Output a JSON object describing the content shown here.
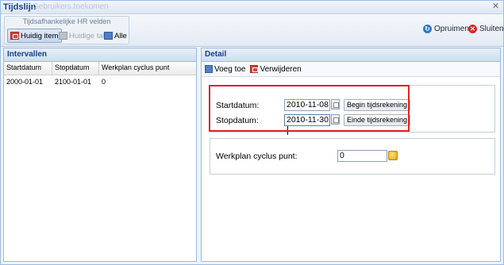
{
  "window": {
    "title": "Tijdslijn",
    "ghost_text": "Gebruikers.toekomen"
  },
  "toolbar": {
    "group_title": "Tijdsafhankelijke HR velden",
    "buttons": [
      {
        "label": "Huidig item",
        "state": "active"
      },
      {
        "label": "Huidige tab",
        "state": "disabled"
      },
      {
        "label": "Alle",
        "state": "normal"
      }
    ],
    "cleanup_label": "Opruimen",
    "close_label": "Sluiten"
  },
  "intervals": {
    "title": "Intervallen",
    "columns": [
      "Startdatum",
      "Stopdatum",
      "Werkplan cyclus punt"
    ],
    "rows": [
      [
        "2000-01-01",
        "2100-01-01",
        "0"
      ]
    ]
  },
  "detail": {
    "title": "Detail",
    "add_label": "Voeg toe",
    "remove_label": "Verwijderen",
    "start_label": "Startdatum:",
    "start_value": "2010-11-08",
    "start_btn": "Begin tijdsrekening",
    "stop_label": "Stopdatum:",
    "stop_value": "2010-11-30",
    "stop_btn": "Einde tijdsrekening",
    "cycle_label": "Werkplan cyclus punt:",
    "cycle_value": "0"
  },
  "colors": {
    "highlight": "#e0242b",
    "header_text": "#15428b"
  }
}
